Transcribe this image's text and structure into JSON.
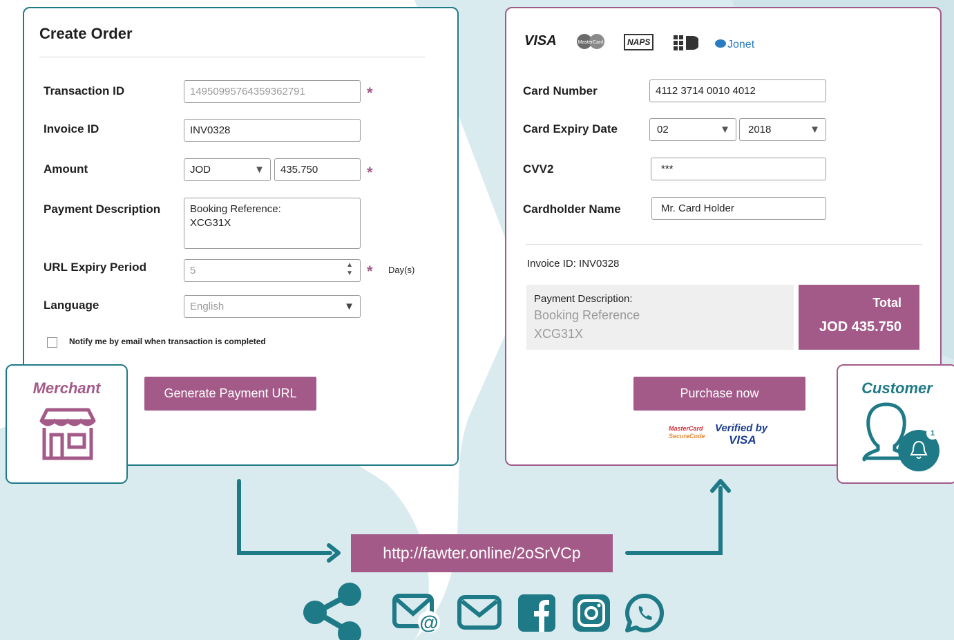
{
  "colors": {
    "teal": "#1e7a87",
    "plum": "#a45a88",
    "bg_tint": "#d9ebee"
  },
  "merchant": {
    "title": "Create Order",
    "transaction_id": {
      "label": "Transaction ID",
      "value": "14950995764359362791",
      "required": "*"
    },
    "invoice_id": {
      "label": "Invoice ID",
      "value": "INV0328"
    },
    "amount": {
      "label": "Amount",
      "currency": "JOD",
      "value": "435.750",
      "required": "*"
    },
    "payment_description": {
      "label": "Payment Description",
      "line1": "Booking Reference:",
      "line2": "XCG31X"
    },
    "url_expiry": {
      "label": "URL Expiry Period",
      "value": "5",
      "required": "*",
      "unit": "Day(s)"
    },
    "language": {
      "label": "Language",
      "value": "English"
    },
    "notify_label": "Notify me by email when transaction is completed",
    "generate_button": "Generate Payment URL",
    "role": "Merchant"
  },
  "customer": {
    "card_brands": {
      "visa": "VISA",
      "mastercard": "MasterCard",
      "naps": "NAPS",
      "jonet": "Jonet"
    },
    "card_number": {
      "label": "Card Number",
      "value": "4112 3714 0010 4012"
    },
    "expiry": {
      "label": "Card Expiry Date",
      "month": "02",
      "year": "2018"
    },
    "cvv": {
      "label": "CVV2",
      "value": "***"
    },
    "holder": {
      "label": "Cardholder Name",
      "value": "Mr. Card Holder"
    },
    "invoice_line": "Invoice ID: INV0328",
    "desc_label": "Payment Description:",
    "desc_line1": "Booking Reference",
    "desc_line2": "XCG31X",
    "total_label": "Total",
    "total_value": "JOD 435.750",
    "purchase_button": "Purchase now",
    "secure_mc_line1": "MasterCard",
    "secure_mc_line2": "SecureCode",
    "secure_visa_line1": "Verified by",
    "secure_visa_line2": "VISA",
    "role": "Customer",
    "notification_count": "1"
  },
  "payment_url": "http://fawter.online/2oSrVCp",
  "share_icons": [
    "share-icon",
    "email-at-icon",
    "mail-icon",
    "facebook-icon",
    "instagram-icon",
    "whatsapp-icon"
  ]
}
